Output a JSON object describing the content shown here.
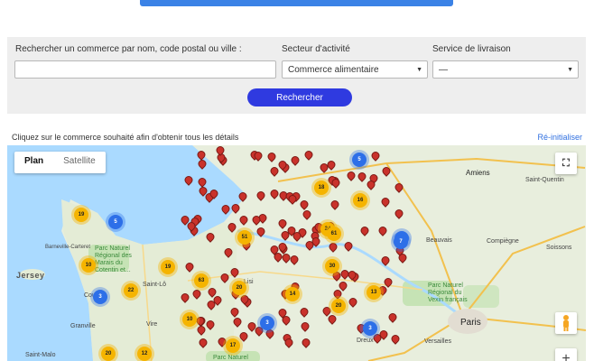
{
  "search": {
    "name_label": "Rechercher un commerce par nom, code postal ou ville :",
    "name_value": "",
    "sector_label": "Secteur d'activité",
    "sector_value": "Commerce alimentaire",
    "delivery_label": "Service de livraison",
    "delivery_value": "—",
    "button_label": "Rechercher"
  },
  "map_header": {
    "instruction": "Cliquez sur le commerce souhaité afin d'obtenir tous les détails",
    "reset_label": "Ré-initialiser"
  },
  "map": {
    "type_plan": "Plan",
    "type_satellite": "Satellite",
    "fullscreen_glyph": "⛶",
    "zoom_in_glyph": "+",
    "places": {
      "amiens": "Amiens",
      "saint_quentin": "Saint-Quentin",
      "beauvais": "Beauvais",
      "compiegne": "Compiègne",
      "soissons": "Soissons",
      "paris": "Paris",
      "versailles": "Versailles",
      "dreux": "Dreux",
      "jersey": "Jersey",
      "barneville": "Barneville-Carteret",
      "saint_lo": "Saint-Lô",
      "vire": "Vire",
      "granville": "Granville",
      "coutances": "Cou",
      "saint_malo": "Saint-Malo",
      "lisieux": "Lisi",
      "parc_marais": "Parc Naturel Régional des Marais du Cotentin et...",
      "parc_vexin": "Parc Naturel Régional du Vexin français",
      "parc_bottom": "Parc Naturel"
    },
    "clusters": [
      {
        "label": "19",
        "color": "yellow"
      },
      {
        "label": "5",
        "color": "blue"
      },
      {
        "label": "10",
        "color": "yellow"
      },
      {
        "label": "19",
        "color": "yellow"
      },
      {
        "label": "22",
        "color": "yellow"
      },
      {
        "label": "3",
        "color": "blue"
      },
      {
        "label": "63",
        "color": "yellow"
      },
      {
        "label": "20",
        "color": "yellow"
      },
      {
        "label": "10",
        "color": "yellow"
      },
      {
        "label": "17",
        "color": "yellow"
      },
      {
        "label": "20",
        "color": "yellow"
      },
      {
        "label": "12",
        "color": "yellow"
      },
      {
        "label": "3",
        "color": "blue"
      },
      {
        "label": "5",
        "color": "blue"
      },
      {
        "label": "51",
        "color": "yellow"
      },
      {
        "label": "18",
        "color": "yellow"
      },
      {
        "label": "16",
        "color": "yellow"
      },
      {
        "label": "5",
        "color": "blue"
      },
      {
        "label": "24",
        "color": "yellow"
      },
      {
        "label": "61",
        "color": "yellow"
      },
      {
        "label": "7",
        "color": "blue"
      },
      {
        "label": "30",
        "color": "yellow"
      },
      {
        "label": "14",
        "color": "yellow"
      },
      {
        "label": "20",
        "color": "yellow"
      },
      {
        "label": "13",
        "color": "yellow"
      },
      {
        "label": "3",
        "color": "blue"
      }
    ]
  },
  "colors": {
    "accent": "#2f3ae0",
    "link": "#2f6fe0",
    "pin": "#c9322b",
    "cluster_yellow": "#f5b400",
    "cluster_blue": "#2d6fe8"
  }
}
